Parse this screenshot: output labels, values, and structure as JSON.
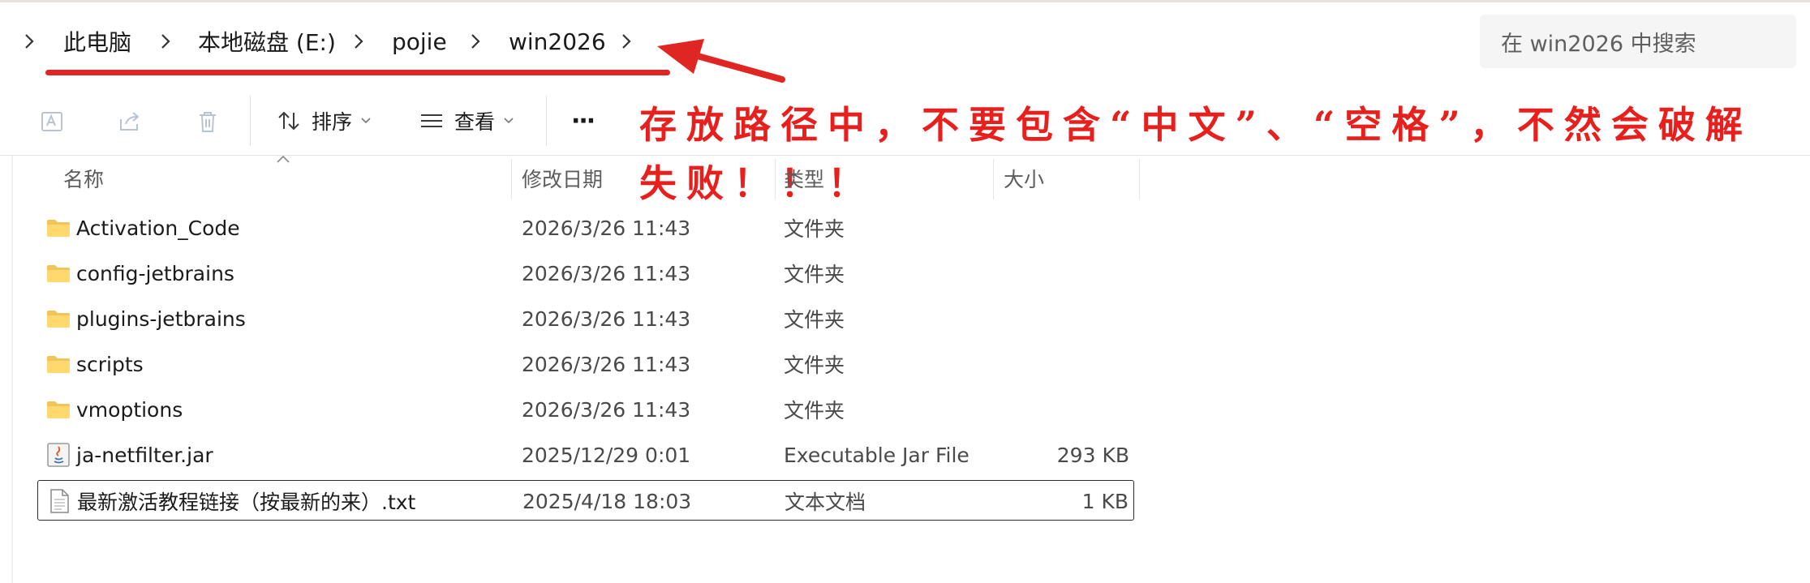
{
  "breadcrumb": {
    "items": [
      "此电脑",
      "本地磁盘 (E:)",
      "pojie",
      "win2026"
    ]
  },
  "search": {
    "placeholder": "在 win2026 中搜索"
  },
  "toolbar": {
    "sort_label": "排序",
    "view_label": "查看",
    "more_label": "···"
  },
  "annotation": {
    "line1": "存放路径中，不要包含“中文”、“空格”，不然会破解",
    "line2": "失败！！！",
    "color": "#e8201d"
  },
  "columns": {
    "name": "名称",
    "date": "修改日期",
    "type": "类型",
    "size": "大小"
  },
  "files": [
    {
      "name": "Activation_Code",
      "date": "2026/3/26 11:43",
      "type": "文件夹",
      "size": "",
      "icon": "folder-icon"
    },
    {
      "name": "config-jetbrains",
      "date": "2026/3/26 11:43",
      "type": "文件夹",
      "size": "",
      "icon": "folder-icon"
    },
    {
      "name": "plugins-jetbrains",
      "date": "2026/3/26 11:43",
      "type": "文件夹",
      "size": "",
      "icon": "folder-icon"
    },
    {
      "name": "scripts",
      "date": "2026/3/26 11:43",
      "type": "文件夹",
      "size": "",
      "icon": "folder-icon"
    },
    {
      "name": "vmoptions",
      "date": "2026/3/26 11:43",
      "type": "文件夹",
      "size": "",
      "icon": "folder-icon"
    },
    {
      "name": "ja-netfilter.jar",
      "date": "2025/12/29 0:01",
      "type": "Executable Jar File",
      "size": "293 KB",
      "icon": "java-jar-icon"
    },
    {
      "name": "最新激活教程链接（按最新的来）.txt",
      "date": "2025/4/18 18:03",
      "type": "文本文档",
      "size": "1 KB",
      "icon": "text-file-icon"
    }
  ],
  "selected_file_index": 6
}
